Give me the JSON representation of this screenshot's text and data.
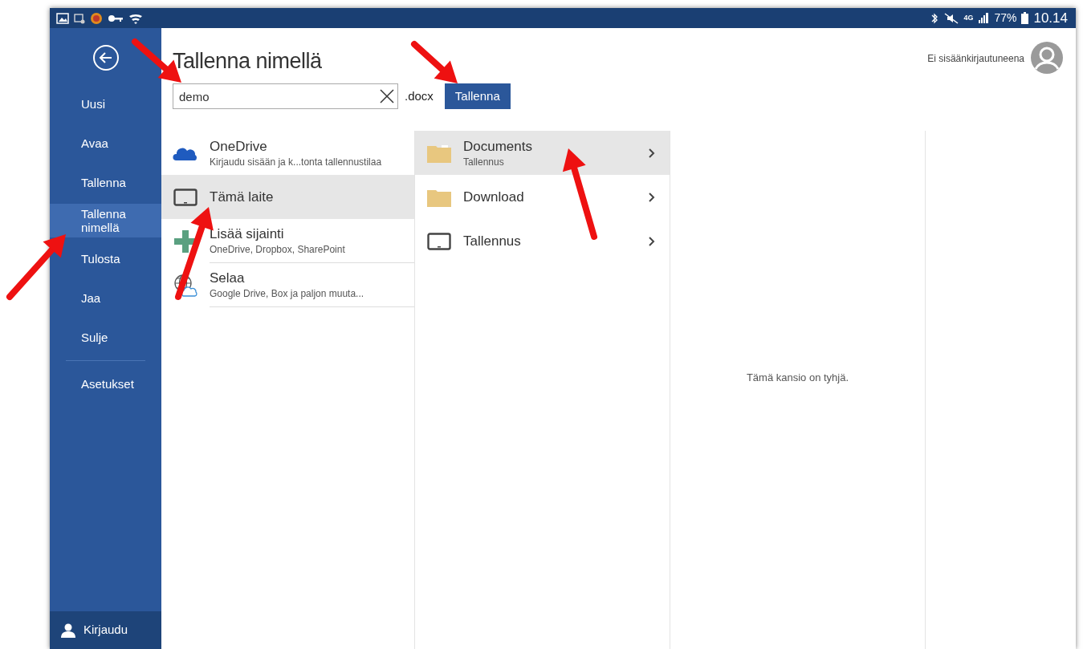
{
  "status_bar": {
    "network": "4G",
    "battery": "77%",
    "time": "10.14"
  },
  "sidebar": {
    "items": [
      {
        "label": "Uusi",
        "selected": false
      },
      {
        "label": "Avaa",
        "selected": false
      },
      {
        "label": "Tallenna",
        "selected": false
      },
      {
        "label": "Tallenna nimellä",
        "selected": true
      },
      {
        "label": "Tulosta",
        "selected": false
      },
      {
        "label": "Jaa",
        "selected": false
      },
      {
        "label": "Sulje",
        "selected": false
      }
    ],
    "settings": "Asetukset",
    "sign_in": "Kirjaudu"
  },
  "header": {
    "title": "Tallenna nimellä",
    "filename": "demo",
    "extension": ".docx",
    "save_button": "Tallenna",
    "account": "Ei sisäänkirjautuneena"
  },
  "locations": [
    {
      "kind": "onedrive",
      "name": "OneDrive",
      "subtitle": "Kirjaudu sisään ja k...tonta tallennustilaa",
      "selected": false
    },
    {
      "kind": "device",
      "name": "Tämä laite",
      "selected": true
    },
    {
      "kind": "add",
      "name": "Lisää sijainti",
      "subtitle": "OneDrive, Dropbox, SharePoint",
      "selected": false
    },
    {
      "kind": "browse",
      "name": "Selaa",
      "subtitle": "Google Drive, Box ja paljon muuta...",
      "selected": false
    }
  ],
  "folders": [
    {
      "kind": "folder",
      "name": "Documents",
      "subtitle": "Tallennus",
      "selected": true
    },
    {
      "kind": "folder",
      "name": "Download",
      "selected": false
    },
    {
      "kind": "device",
      "name": "Tallennus",
      "selected": false
    }
  ],
  "preview": {
    "empty_text": "Tämä kansio on tyhjä."
  }
}
